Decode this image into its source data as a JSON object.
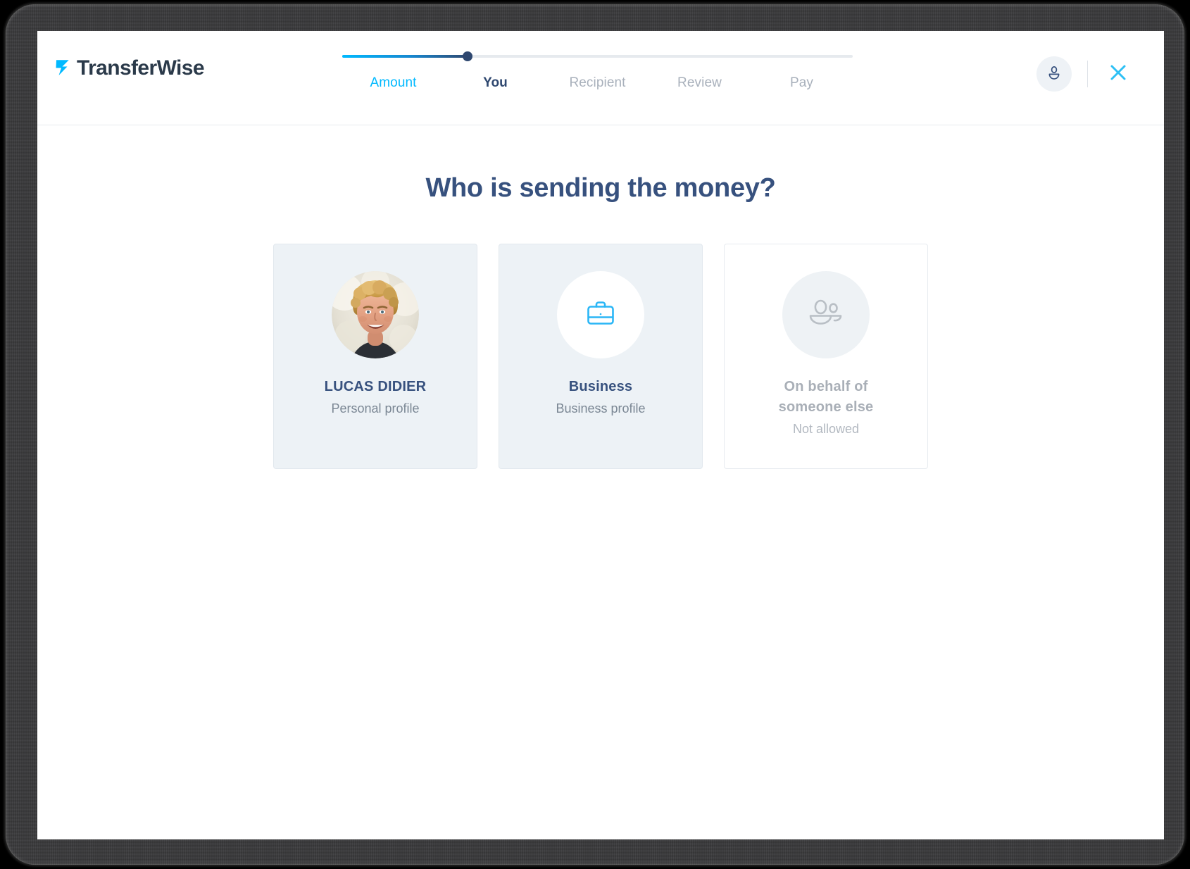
{
  "brand": {
    "name": "TransferWise",
    "accent_cyan": "#00b9ff",
    "accent_navy": "#37517e",
    "logo_icon": "transferwise-arrow-icon"
  },
  "header": {
    "stepper": {
      "progress_percent": 24.5,
      "steps": [
        {
          "label": "Amount",
          "state": "done"
        },
        {
          "label": "You",
          "state": "current"
        },
        {
          "label": "Recipient",
          "state": "todo"
        },
        {
          "label": "Review",
          "state": "todo"
        },
        {
          "label": "Pay",
          "state": "todo"
        }
      ]
    },
    "account_icon": "user-avatar-icon",
    "close_icon": "close-icon"
  },
  "main": {
    "title": "Who is sending the money?",
    "cards": [
      {
        "media": "profile-photo",
        "title": "LUCAS DIDIER",
        "subtitle": "Personal profile",
        "style": "fill",
        "enabled": true
      },
      {
        "media": "briefcase-icon",
        "title": "Business",
        "subtitle": "Business profile",
        "style": "fill",
        "enabled": true
      },
      {
        "media": "people-group-icon",
        "title": "On behalf of someone else",
        "subtitle": "Not allowed",
        "style": "plain",
        "enabled": false
      }
    ]
  }
}
